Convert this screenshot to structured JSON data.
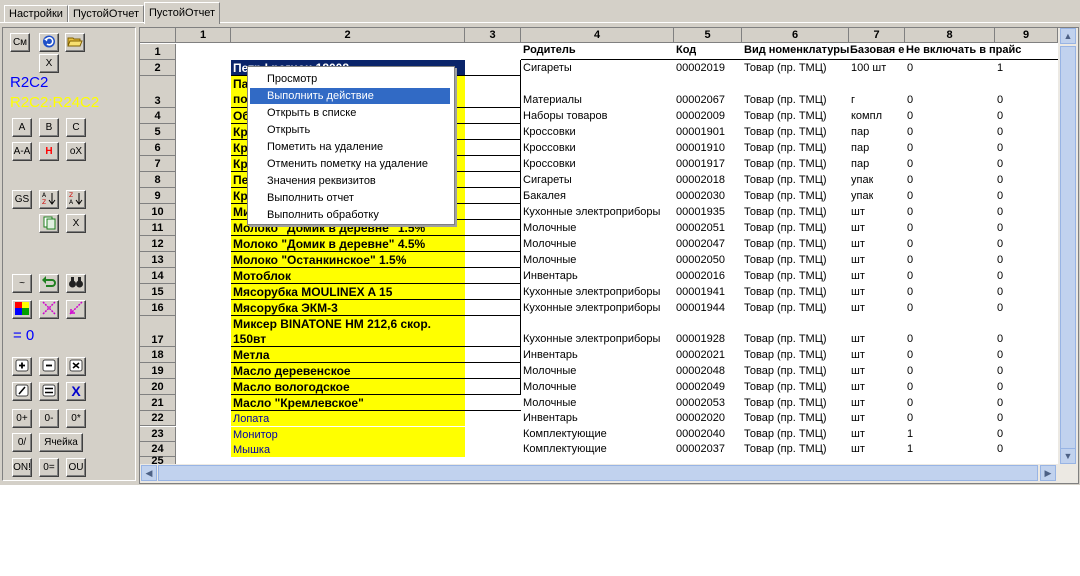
{
  "tabs": [
    {
      "label": "Настройки"
    },
    {
      "label": "ПустойОтчет"
    },
    {
      "label": "ПустойОтчет"
    }
  ],
  "toolbar": {
    "sm": "См",
    "refresh_icon": "refresh-icon",
    "open_icon": "folder-open-icon",
    "close": "X",
    "r2c2_blue": "R2C2",
    "r2c2_range": "R2C2:R24C2",
    "a": "A",
    "b": "B",
    "c": "C",
    "aa": "A-A",
    "h": "H",
    "ox": "oX",
    "gs": "GS",
    "x2": "X",
    "eq0": "= 0",
    "x3": "X",
    "o_plus": "0+",
    "o_minus": "0-",
    "o_star": "0*",
    "o_slash": "0/",
    "cell": "Ячейка",
    "on": "ON!",
    "o_eq": "0=",
    "ou": "OU",
    "colors": {
      "blue": "#0000ff",
      "yellow": "#ffff00"
    }
  },
  "grid": {
    "col_headers": [
      "1",
      "2",
      "3",
      "4",
      "5",
      "6",
      "7",
      "8",
      "9"
    ],
    "header_row": [
      "Родитель",
      "Код",
      "Вид номенклатуры",
      "Базовая е",
      "Не включать в прайс"
    ],
    "rows": [
      {
        "n": "1"
      },
      {
        "n": "2",
        "name": "Петр I регион 18008",
        "parent": "Сигареты",
        "code": "00002019",
        "kind": "Товар (пр. ТМЦ)",
        "unit": "100 шт",
        "c8": "0",
        "c9": "1"
      },
      {
        "n": "3",
        "name_a": "Па",
        "name_b": "по",
        "parent": "Материалы",
        "code": "00002067",
        "kind": "Товар (пр. ТМЦ)",
        "unit": "г",
        "c8": "0",
        "c9": "0"
      },
      {
        "n": "4",
        "name": "Об",
        "parent": "Наборы товаров",
        "code": "00002009",
        "kind": "Товар (пр. ТМЦ)",
        "unit": "компл",
        "c8": "0",
        "c9": "0"
      },
      {
        "n": "5",
        "name": "Кр",
        "parent": "Кроссовки",
        "code": "00001901",
        "kind": "Товар (пр. ТМЦ)",
        "unit": "пар",
        "c8": "0",
        "c9": "0"
      },
      {
        "n": "6",
        "name": "Кр",
        "parent": "Кроссовки",
        "code": "00001910",
        "kind": "Товар (пр. ТМЦ)",
        "unit": "пар",
        "c8": "0",
        "c9": "0"
      },
      {
        "n": "7",
        "name": "Кр",
        "parent": "Кроссовки",
        "code": "00001917",
        "kind": "Товар (пр. ТМЦ)",
        "unit": "пар",
        "c8": "0",
        "c9": "0"
      },
      {
        "n": "8",
        "name": "Пе",
        "parent": "Сигареты",
        "code": "00002018",
        "kind": "Товар (пр. ТМЦ)",
        "unit": "упак",
        "c8": "0",
        "c9": "0"
      },
      {
        "n": "9",
        "name": "Кр",
        "parent": "Бакалея",
        "code": "00002030",
        "kind": "Товар (пр. ТМЦ)",
        "unit": "упак",
        "c8": "0",
        "c9": "0"
      },
      {
        "n": "10",
        "name": "Ми",
        "parent": "Кухонные электроприборы",
        "code": "00001935",
        "kind": "Товар (пр. ТМЦ)",
        "unit": "шт",
        "c8": "0",
        "c9": "0"
      },
      {
        "n": "11",
        "name": "Молоко \"Домик в деревне\" 1.5%",
        "parent": "Молочные",
        "code": "00002051",
        "kind": "Товар (пр. ТМЦ)",
        "unit": "шт",
        "c8": "0",
        "c9": "0"
      },
      {
        "n": "12",
        "name": "Молоко \"Домик в деревне\" 4.5%",
        "parent": "Молочные",
        "code": "00002047",
        "kind": "Товар (пр. ТМЦ)",
        "unit": "шт",
        "c8": "0",
        "c9": "0"
      },
      {
        "n": "13",
        "name": "Молоко \"Останкинское\" 1.5%",
        "parent": "Молочные",
        "code": "00002050",
        "kind": "Товар (пр. ТМЦ)",
        "unit": "шт",
        "c8": "0",
        "c9": "0"
      },
      {
        "n": "14",
        "name": "Мотоблок",
        "parent": "Инвентарь",
        "code": "00002016",
        "kind": "Товар (пр. ТМЦ)",
        "unit": "шт",
        "c8": "0",
        "c9": "0"
      },
      {
        "n": "15",
        "name": "Мясорубка MOULINEX  A 15",
        "parent": "Кухонные электроприборы",
        "code": "00001941",
        "kind": "Товар (пр. ТМЦ)",
        "unit": "шт",
        "c8": "0",
        "c9": "0"
      },
      {
        "n": "16",
        "name": "Мясорубка ЭКМ-3",
        "parent": "Кухонные электроприборы",
        "code": "00001944",
        "kind": "Товар (пр. ТМЦ)",
        "unit": "шт",
        "c8": "0",
        "c9": "0"
      },
      {
        "n": "17",
        "name_a": "Миксер BINATONE HM 212,6 скор.",
        "name_b": "150вт",
        "parent": "Кухонные электроприборы",
        "code": "00001928",
        "kind": "Товар (пр. ТМЦ)",
        "unit": "шт",
        "c8": "0",
        "c9": "0"
      },
      {
        "n": "18",
        "name": "Метла",
        "parent": "Инвентарь",
        "code": "00002021",
        "kind": "Товар (пр. ТМЦ)",
        "unit": "шт",
        "c8": "0",
        "c9": "0"
      },
      {
        "n": "19",
        "name": "Масло деревенское",
        "parent": "Молочные",
        "code": "00002048",
        "kind": "Товар (пр. ТМЦ)",
        "unit": "шт",
        "c8": "0",
        "c9": "0"
      },
      {
        "n": "20",
        "name": "Масло вологодское",
        "parent": "Молочные",
        "code": "00002049",
        "kind": "Товар (пр. ТМЦ)",
        "unit": "шт",
        "c8": "0",
        "c9": "0"
      },
      {
        "n": "21",
        "name": "Масло \"Кремлевское\"",
        "parent": "Молочные",
        "code": "00002053",
        "kind": "Товар (пр. ТМЦ)",
        "unit": "шт",
        "c8": "0",
        "c9": "0"
      },
      {
        "n": "22",
        "name": "Лопата",
        "parent": "Инвентарь",
        "code": "00002020",
        "kind": "Товар (пр. ТМЦ)",
        "unit": "шт",
        "c8": "0",
        "c9": "0"
      },
      {
        "n": "23",
        "name": "Монитор",
        "parent": "Комплектующие",
        "code": "00002040",
        "kind": "Товар (пр. ТМЦ)",
        "unit": "шт",
        "c8": "1",
        "c9": "0"
      },
      {
        "n": "24",
        "name": "Мышка",
        "parent": "Комплектующие",
        "code": "00002037",
        "kind": "Товар (пр. ТМЦ)",
        "unit": "шт",
        "c8": "1",
        "c9": "0"
      },
      {
        "n": "25"
      }
    ]
  },
  "context_menu": {
    "items": [
      {
        "label": "Просмотр"
      },
      {
        "label": "Выполнить действие"
      },
      {
        "label": "Открыть в списке"
      },
      {
        "label": "Открыть"
      },
      {
        "label": "Пометить на удаление"
      },
      {
        "label": "Отменить пометку на удаление"
      },
      {
        "label": "Значения реквизитов"
      },
      {
        "label": "Выполнить отчет"
      },
      {
        "label": "Выполнить обработку"
      }
    ],
    "selected_index": 1,
    "selection_color": "#316ac5"
  }
}
